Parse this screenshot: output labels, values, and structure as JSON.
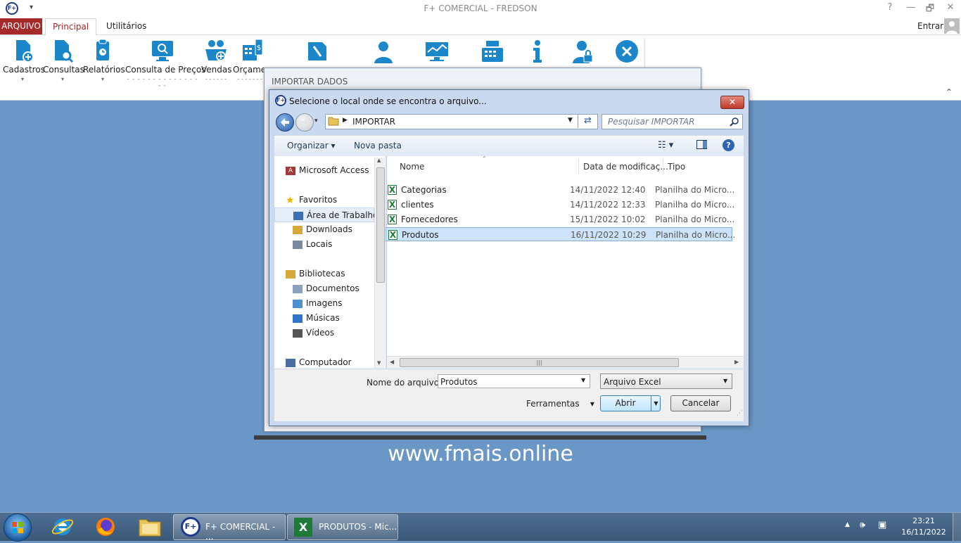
{
  "app": {
    "title": "F+ COMERCIAL - FREDSON",
    "logo": "F+",
    "quick_access": "▾",
    "window_buttons": {
      "help": "?",
      "minimize": "—",
      "restore": "🗗",
      "close": "✕"
    }
  },
  "tabs": {
    "arquivo": "ARQUIVO",
    "items": [
      "Principal",
      "Utilitários"
    ],
    "active": "Principal",
    "entrar": "Entrar"
  },
  "ribbon": {
    "buttons": [
      {
        "label": "Cadastros",
        "icon": "file-add-icon",
        "dropdown": true
      },
      {
        "label": "Consultas",
        "icon": "file-search-icon",
        "dropdown": true
      },
      {
        "label": "Relatórios",
        "icon": "report-icon",
        "dropdown": true
      },
      {
        "label": "Consulta de Preços",
        "icon": "price-monitor-icon"
      },
      {
        "label": "Vendas",
        "icon": "basket-icon"
      },
      {
        "label": "Orçamentos",
        "icon": "calculator-icon"
      }
    ],
    "collapse": "⌃"
  },
  "importar_dialog": {
    "title": "IMPORTAR DADOS"
  },
  "file_dialog": {
    "caption": "Selecione o local onde se encontra o arquivo...",
    "close": "✕",
    "address": "IMPORTAR",
    "search_placeholder": "Pesquisar IMPORTAR",
    "toolbar": {
      "organize": "Organizar",
      "new_folder": "Nova pasta"
    },
    "nav": [
      {
        "label": "Microsoft Access",
        "icon": "access-icon",
        "indent": 0,
        "group": true
      },
      {
        "label": "Favoritos",
        "icon": "star-icon",
        "indent": 0,
        "group": true
      },
      {
        "label": "Área de Trabalho",
        "icon": "desktop-icon",
        "indent": 1,
        "selected": true
      },
      {
        "label": "Downloads",
        "icon": "downloads-icon",
        "indent": 1
      },
      {
        "label": "Locais",
        "icon": "places-icon",
        "indent": 1
      },
      {
        "label": "Bibliotecas",
        "icon": "library-icon",
        "indent": 0,
        "group": true
      },
      {
        "label": "Documentos",
        "icon": "documents-icon",
        "indent": 1
      },
      {
        "label": "Imagens",
        "icon": "images-icon",
        "indent": 1
      },
      {
        "label": "Músicas",
        "icon": "music-icon",
        "indent": 1
      },
      {
        "label": "Vídeos",
        "icon": "video-icon",
        "indent": 1
      },
      {
        "label": "Computador",
        "icon": "computer-icon",
        "indent": 0,
        "group": true
      }
    ],
    "columns": [
      "Nome",
      "Data de modificaç...",
      "Tipo"
    ],
    "files": [
      {
        "name": "Categorias",
        "date": "14/11/2022 12:40",
        "type": "Planilha do Micro..."
      },
      {
        "name": "clientes",
        "date": "14/11/2022 12:33",
        "type": "Planilha do Micro..."
      },
      {
        "name": "Fornecedores",
        "date": "15/11/2022 10:02",
        "type": "Planilha do Micro..."
      },
      {
        "name": "Produtos",
        "date": "16/11/2022 10:29",
        "type": "Planilha do Micro..."
      }
    ],
    "selected_file": "Produtos",
    "filename_label": "Nome do arquivo:",
    "filename_value": "Produtos",
    "filetype_value": "Arquivo Excel",
    "tools": "Ferramentas",
    "open": "Abrir",
    "cancel": "Cancelar"
  },
  "website": "www.fmais.online",
  "taskbar": {
    "tasks": [
      {
        "label": "F+ COMERCIAL - ...",
        "icon": "fplus-icon"
      },
      {
        "label": "PRODUTOS - Mic...",
        "icon": "excel-icon"
      }
    ],
    "time": "23:21",
    "date": "16/11/2022"
  },
  "colors": {
    "accent": "#a62a2a",
    "ribbon_icon": "#1b86c9",
    "desktop": "#6a97c5"
  }
}
